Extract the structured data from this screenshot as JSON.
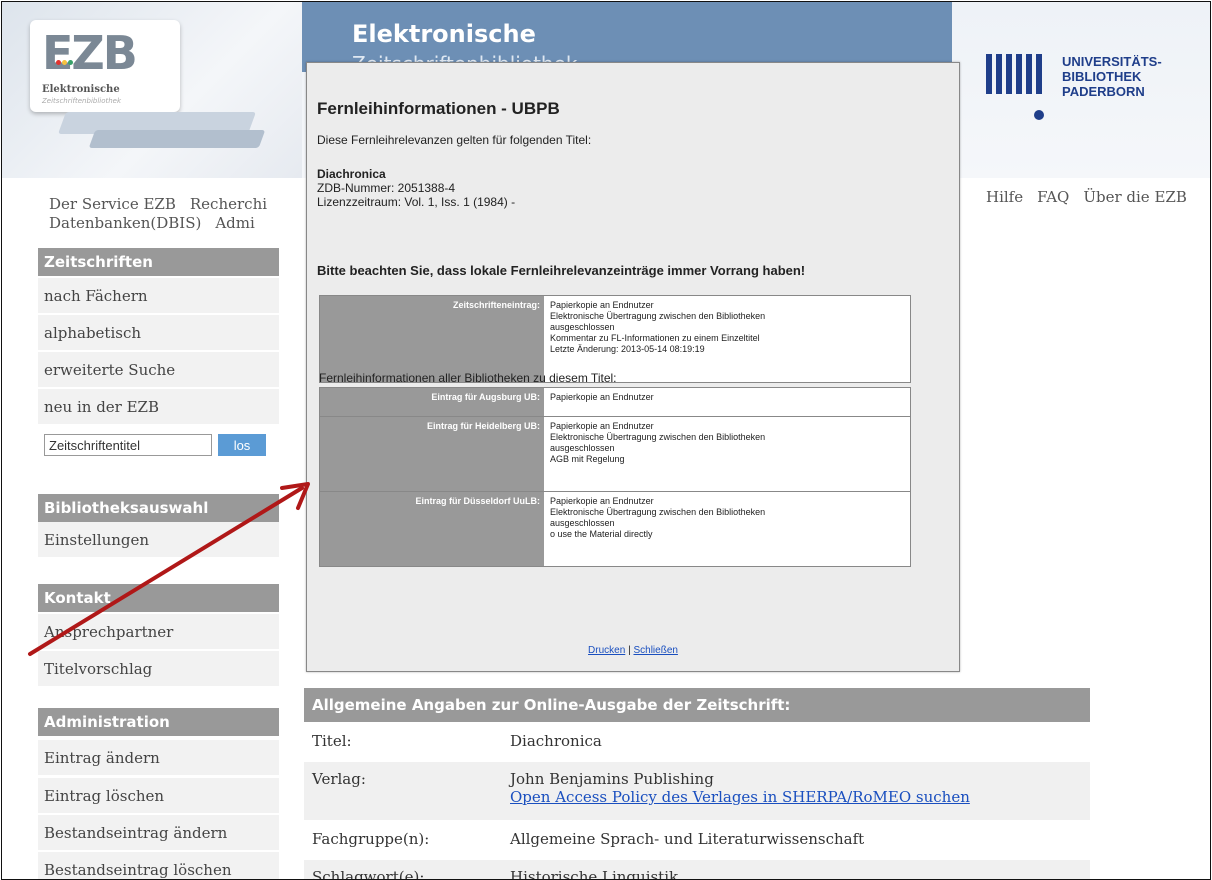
{
  "header": {
    "logo_text": "EZB",
    "logo_sub1": "Elektronische",
    "logo_sub2": "Zeitschriftenbibliothek",
    "title": "Elektronische",
    "title2": "Zeitschriftenbibliothek",
    "partner_logo_lines": [
      "UNIVERSITÄTS-",
      "BIBLIOTHEK",
      "PADERBORN"
    ]
  },
  "nav": {
    "row1": [
      "Der Service EZB",
      "Recherchi"
    ],
    "row2": [
      "Datenbanken(DBIS)",
      "Admi"
    ],
    "right": [
      "Hilfe",
      "FAQ",
      "Über die EZB"
    ]
  },
  "sidebar": {
    "zeitschriften": {
      "heading": "Zeitschriften",
      "items": [
        "nach Fächern",
        "alphabetisch",
        "erweiterte Suche",
        "neu in der EZB"
      ]
    },
    "search": {
      "placeholder": "Zeitschriftentitel",
      "button": "los"
    },
    "bibliothek": {
      "heading": "Bibliotheksauswahl",
      "items": [
        "Einstellungen"
      ]
    },
    "kontakt": {
      "heading": "Kontakt",
      "items": [
        "Ansprechpartner",
        "Titelvorschlag"
      ]
    },
    "admin": {
      "heading": "Administration",
      "items": [
        "Eintrag ändern",
        "Eintrag löschen",
        "Bestandseintrag ändern",
        "Bestandseintrag löschen"
      ]
    }
  },
  "details": {
    "heading": "Allgemeine Angaben zur Online-Ausgabe der Zeitschrift:",
    "rows": [
      {
        "key": "Titel:",
        "value": "Diachronica"
      },
      {
        "key": "Verlag:",
        "value": "John Benjamins Publishing",
        "link": "Open Access Policy des Verlages in SHERPA/RoMEO suchen"
      },
      {
        "key": "Fachgruppe(n):",
        "value": "Allgemeine Sprach- und Literaturwissenschaft"
      },
      {
        "key": "Schlagwort(e):",
        "value": "Historische Linguistik"
      }
    ]
  },
  "modal": {
    "title": "Fernleihinformationen - UBPB",
    "intro": "Diese Fernleihrelevanzen gelten für folgenden Titel:",
    "journal_title": "Diachronica",
    "zdb": "ZDB-Nummer: 2051388-4",
    "license": "Lizenzzeitraum: Vol. 1, Iss. 1 (1984) -",
    "warning": "Bitte beachten Sie, dass lokale Fernleihrelevanzeinträge immer Vorrang haben!",
    "local_entry": {
      "key": "Zeitschrifteneintrag:",
      "lines": [
        "Papierkopie an Endnutzer",
        "Elektronische Übertragung zwischen den Bibliotheken",
        "ausgeschlossen",
        "Kommentar zu FL-Informationen zu einem Einzeltitel",
        "Letzte Änderung: 2013-05-14 08:19:19"
      ]
    },
    "all_heading": "Fernleihinformationen aller Bibliotheken zu diesem Titel:",
    "libraries": [
      {
        "key": "Eintrag für Augsburg UB:",
        "lines": [
          "Papierkopie an Endnutzer"
        ]
      },
      {
        "key": "Eintrag für Heidelberg UB:",
        "lines": [
          "Papierkopie an Endnutzer",
          "Elektronische Übertragung zwischen den Bibliotheken",
          "ausgeschlossen",
          "AGB mit Regelung"
        ]
      },
      {
        "key": "Eintrag für Düsseldorf UuLB:",
        "lines": [
          "Papierkopie an Endnutzer",
          "Elektronische Übertragung zwischen den Bibliotheken",
          "ausgeschlossen",
          "o use the Material directly"
        ]
      }
    ],
    "print": "Drucken",
    "separator": "|",
    "close": "Schließen"
  },
  "colors": {
    "arrow": "#b01818",
    "sidebar_heading": "#999999",
    "link": "#1a4fbf",
    "title_band": "#6d8fb5"
  }
}
